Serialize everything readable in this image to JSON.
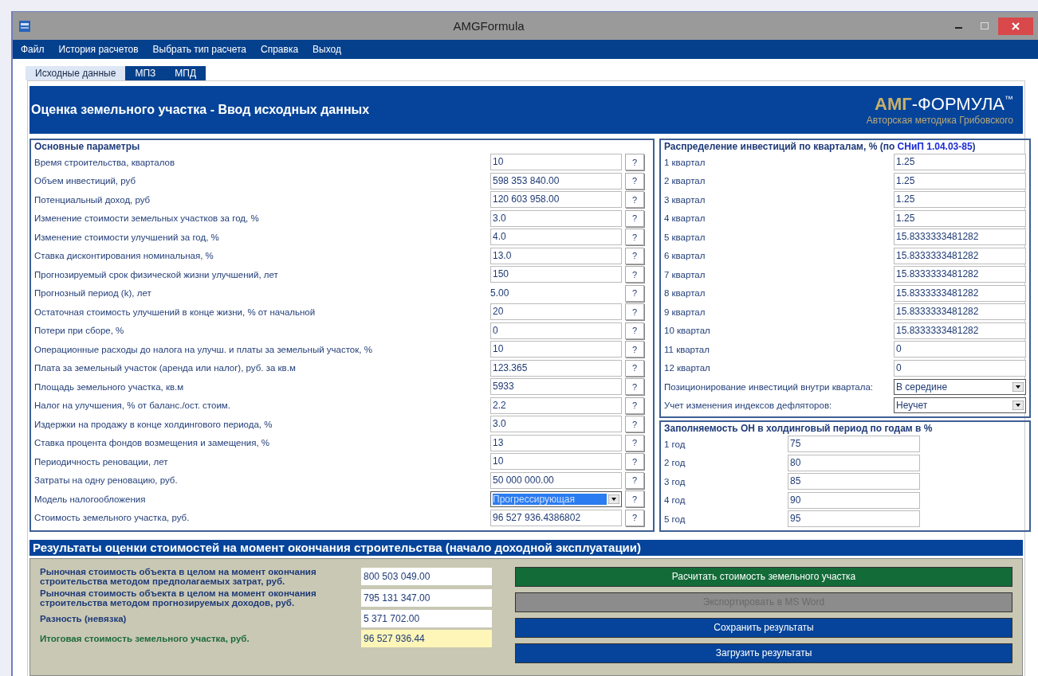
{
  "window": {
    "title": "AMGFormula"
  },
  "menu": [
    "Файл",
    "История расчетов",
    "Выбрать тип расчета",
    "Справка",
    "Выход"
  ],
  "tabs": [
    {
      "label": "Исходные данные",
      "selected": true
    },
    {
      "label": "МПЗ",
      "selected": false
    },
    {
      "label": "МПД",
      "selected": false
    }
  ],
  "header": {
    "title": "Оценка земельного участка - Ввод исходных данных",
    "logo_accent": "АМГ",
    "logo_rest": "-ФОРМУЛА",
    "logo_mark": "™",
    "logo_subtitle": "Авторская методика Грибовского"
  },
  "main_params": {
    "title": "Основные параметры",
    "rows": [
      {
        "label": "Время строительства, кварталов",
        "value": "10",
        "kind": "field",
        "help": "?"
      },
      {
        "label": "Объем инвестиций, руб",
        "value": "598 353 840.00",
        "kind": "field",
        "help": "?"
      },
      {
        "label": "Потенциальный доход, руб",
        "value": "120 603 958.00",
        "kind": "field",
        "help": "?"
      },
      {
        "label": "Изменение стоимости земельных участков за год, %",
        "value": "3.0",
        "kind": "field",
        "help": "?"
      },
      {
        "label": "Изменение стоимости улучшений за год, %",
        "value": "4.0",
        "kind": "field",
        "help": "?"
      },
      {
        "label": "Ставка дисконтирования номинальная, %",
        "value": "13.0",
        "kind": "field",
        "help": "?"
      },
      {
        "label": "Прогнозируемый срок физической жизни улучшений, лет",
        "value": "150",
        "kind": "field",
        "help": "?"
      },
      {
        "label": "Прогнозный период (k), лет",
        "value": "5.00",
        "kind": "readonly",
        "help": "?"
      },
      {
        "label": "Остаточная стоимость улучшений в конце жизни, % от начальной",
        "value": "20",
        "kind": "field",
        "help": "?"
      },
      {
        "label": "Потери при сборе, %",
        "value": "0",
        "kind": "field",
        "help": "?"
      },
      {
        "label": "Операционные расходы до налога на улучш. и платы за земельный участок, %",
        "value": "10",
        "kind": "field",
        "help": "?"
      },
      {
        "label": "Плата за земельный участок (аренда или налог), руб. за кв.м",
        "value": "123.365",
        "kind": "field",
        "help": "?"
      },
      {
        "label": "Площадь земельного участка, кв.м",
        "value": "5933",
        "kind": "field",
        "help": "?"
      },
      {
        "label": "Налог на улучшения, % от баланс./ост. стоим.",
        "value": "2.2",
        "kind": "field",
        "help": "?"
      },
      {
        "label": "Издержки на продажу в конце холдингового периода, %",
        "value": "3.0",
        "kind": "field",
        "help": "?"
      },
      {
        "label": "Ставка процента фондов возмещения и замещения, %",
        "value": "13",
        "kind": "field",
        "help": "?"
      },
      {
        "label": "Периодичность реновации, лет",
        "value": "10",
        "kind": "field",
        "help": "?"
      },
      {
        "label": "Затраты на одну реновацию, руб.",
        "value": "50 000 000.00",
        "kind": "field",
        "help": "?"
      },
      {
        "label": "Модель налогообложения",
        "value": "Прогрессирующая",
        "kind": "select",
        "help": "?"
      },
      {
        "label": "Стоимость земельного участка, руб.",
        "value": "96 527 936.4386802",
        "kind": "field",
        "help": "?"
      }
    ]
  },
  "distribution": {
    "title": "Распределение инвестиций по кварталам, % (по ",
    "title_link": "СНиП 1.04.03-85",
    "title_end": ")",
    "rows": [
      {
        "label": "1 квартал",
        "value": "1.25"
      },
      {
        "label": "2 квартал",
        "value": "1.25"
      },
      {
        "label": "3 квартал",
        "value": "1.25"
      },
      {
        "label": "4 квартал",
        "value": "1.25"
      },
      {
        "label": "5 квартал",
        "value": "15.8333333481282"
      },
      {
        "label": "6 квартал",
        "value": "15.8333333481282"
      },
      {
        "label": "7 квартал",
        "value": "15.8333333481282"
      },
      {
        "label": "8 квартал",
        "value": "15.8333333481282"
      },
      {
        "label": "9 квартал",
        "value": "15.8333333481282"
      },
      {
        "label": "10 квартал",
        "value": "15.8333333481282"
      },
      {
        "label": "11 квартал",
        "value": "0"
      },
      {
        "label": "12 квартал",
        "value": "0"
      }
    ],
    "selects": [
      {
        "label": "Позиционирование инвестиций  внутри квартала:",
        "value": "В середине"
      },
      {
        "label": "Учет изменения индексов дефляторов:",
        "value": "Неучет"
      }
    ]
  },
  "occupancy": {
    "title": "Заполняемость ОН  в холдинговый период по годам в %",
    "rows": [
      {
        "label": "1 год",
        "value": "75"
      },
      {
        "label": "2 год",
        "value": "80"
      },
      {
        "label": "3 год",
        "value": "85"
      },
      {
        "label": "4 год",
        "value": "90"
      },
      {
        "label": "5 год",
        "value": "95"
      }
    ]
  },
  "results": {
    "title": "Результаты оценки стоимостей на момент окончания строительства (начало доходной эксплуатации)",
    "items": [
      {
        "label": "Рыночная стоимость объекта в целом на момент окончания строительства методом предполагаемых затрат, руб.",
        "value": "800 503 049.00",
        "kind": "normal"
      },
      {
        "label": "Рыночная стоимость объекта в целом на момент окончания строительства методом прогнозируемых доходов, руб.",
        "value": "795 131 347.00",
        "kind": "normal"
      },
      {
        "label": "Разность (невязка)",
        "value": "5 371 702.00",
        "kind": "normal"
      },
      {
        "label": "Итоговая стоимость земельного участка, руб.",
        "value": "96 527 936.44",
        "kind": "total"
      }
    ],
    "buttons": [
      {
        "label": "Расчитать стоимость земельного участка",
        "color": "#136b38",
        "disabled": false
      },
      {
        "label": "Экспортировать в MS Word",
        "color": "#8c8c8c",
        "disabled": true
      },
      {
        "label": "Сохранить результаты",
        "color": "#05449a",
        "disabled": false
      },
      {
        "label": "Загрузить результаты",
        "color": "#05449a",
        "disabled": false
      }
    ]
  }
}
